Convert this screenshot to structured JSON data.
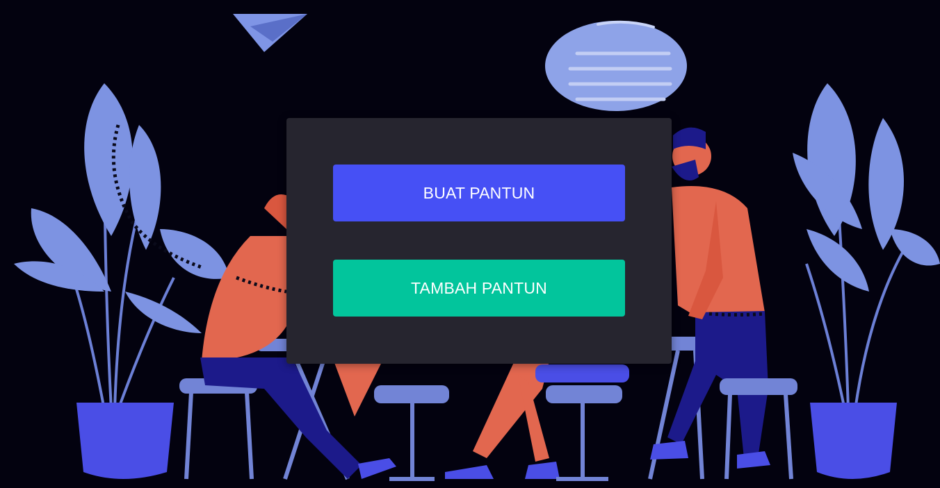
{
  "colors": {
    "background": "#03020f",
    "panel": "#26252f",
    "primary_button": "#4650f5",
    "secondary_button": "#02c59c",
    "illustration_blue": "#7a8fe0",
    "illustration_orange": "#e2674f",
    "illustration_navy": "#1a1880"
  },
  "menu": {
    "create_label": "BUAT PANTUN",
    "add_label": "TAMBAH PANTUN"
  },
  "illustration": {
    "icons": [
      "paper-plane-icon",
      "speech-bubble-icon",
      "plant-icon",
      "person-icon",
      "table-icon",
      "stool-icon"
    ]
  }
}
